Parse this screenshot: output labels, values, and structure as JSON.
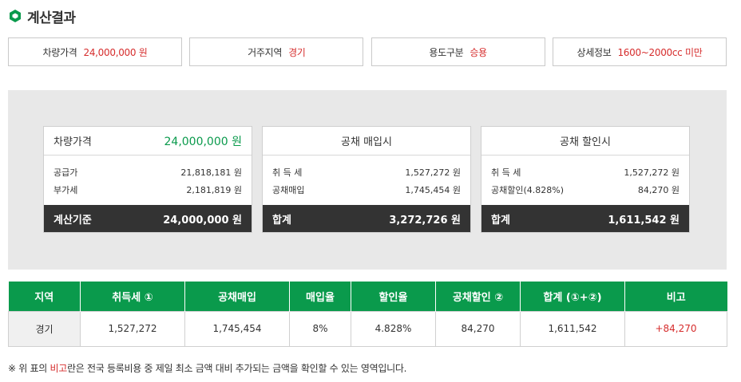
{
  "header": {
    "title": "계산결과"
  },
  "summary": [
    {
      "label": "차량가격",
      "value": "24,000,000 원"
    },
    {
      "label": "거주지역",
      "value": "경기"
    },
    {
      "label": "용도구분",
      "value": "승용"
    },
    {
      "label": "상세정보",
      "value": "1600~2000cc 미만"
    }
  ],
  "card_price": {
    "title": "차량가격",
    "total": "24,000,000 원",
    "rows": [
      {
        "label": "공급가",
        "value": "21,818,181 원"
      },
      {
        "label": "부가세",
        "value": "2,181,819 원"
      }
    ],
    "footer_label": "계산기준",
    "footer_value": "24,000,000 원"
  },
  "card_buy": {
    "title": "공채 매입시",
    "rows": [
      {
        "label": "취 득 세",
        "value": "1,527,272 원"
      },
      {
        "label": "공채매입",
        "value": "1,745,454 원"
      }
    ],
    "footer_label": "합계",
    "footer_value": "3,272,726 원"
  },
  "card_discount": {
    "title": "공채 할인시",
    "rows": [
      {
        "label": "취 득 세",
        "value": "1,527,272 원"
      },
      {
        "label": "공채할인(4.828%)",
        "value": "84,270 원"
      }
    ],
    "footer_label": "합계",
    "footer_value": "1,611,542 원"
  },
  "table": {
    "headers": [
      "지역",
      "취득세 ①",
      "공채매입",
      "매입율",
      "할인율",
      "공채할인 ②",
      "합계 (①+②)",
      "비고"
    ],
    "row": [
      "경기",
      "1,527,272",
      "1,745,454",
      "8%",
      "4.828%",
      "84,270",
      "1,611,542",
      "+84,270"
    ]
  },
  "note": {
    "prefix": "※ 위 표의 ",
    "highlight": "비고",
    "suffix": "란은 전국 등록비용 중 제일 최소 금액 대비 추가되는 금액을 확인할 수 있는 영역입니다."
  },
  "colors": {
    "accent_green": "#0a9a4c",
    "highlight_red": "#d62d2d",
    "dark_footer": "#333333"
  },
  "icons": {
    "title": "green-hexagon-icon"
  }
}
